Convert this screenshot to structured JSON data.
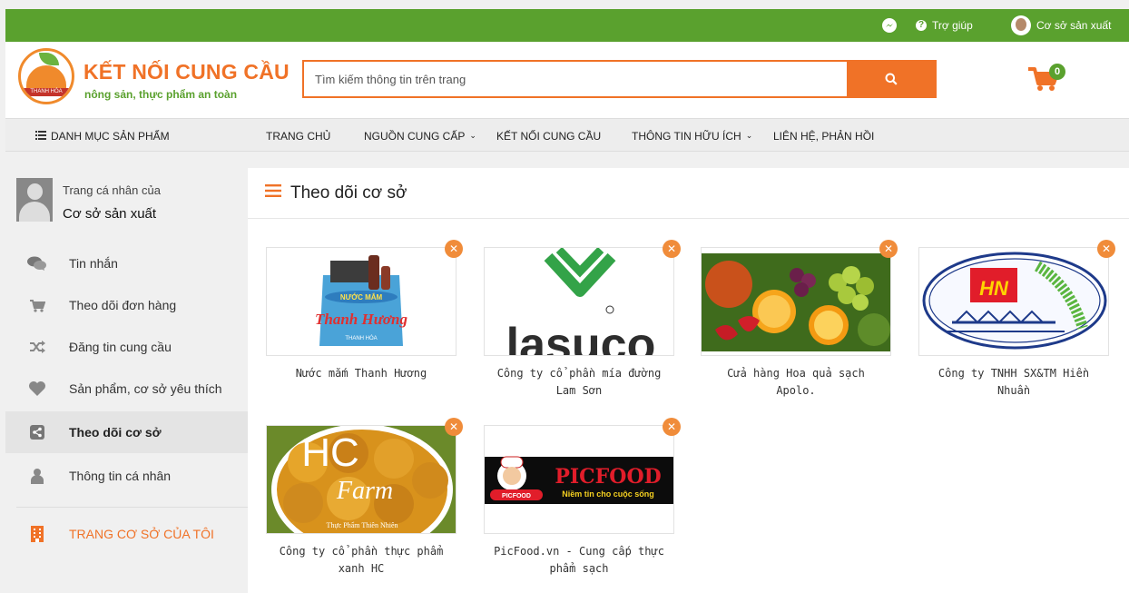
{
  "topbar": {
    "help": "Trợ giúp",
    "account": "Cơ sở sản xuất"
  },
  "logo": {
    "title": "KẾT NỐI CUNG CẦU",
    "subtitle": "nông sản, thực phẩm an toàn",
    "badge": "THANH HÓA"
  },
  "search": {
    "placeholder": "Tìm kiếm thông tin trên trang"
  },
  "cart": {
    "count": "0"
  },
  "nav": {
    "categories": "DANH MỤC SẢN PHẨM",
    "items": [
      "TRANG CHỦ",
      "NGUỒN CUNG CẤP",
      "KẾT NỐI CUNG CẦU",
      "THÔNG TIN HỮU ÍCH",
      "LIÊN HỆ, PHẢN HỒI"
    ]
  },
  "sidebar": {
    "profile_label": "Trang cá nhân của",
    "profile_name": "Cơ sở sản xuất",
    "items": [
      {
        "label": "Tin nhắn",
        "icon": "chat-icon"
      },
      {
        "label": "Theo dõi đơn hàng",
        "icon": "cart-icon"
      },
      {
        "label": "Đăng tin cung cầu",
        "icon": "shuffle-icon"
      },
      {
        "label": "Sản phẩm, cơ sở yêu thích",
        "icon": "heart-icon"
      },
      {
        "label": "Theo dõi cơ sở",
        "icon": "share-icon"
      },
      {
        "label": "Thông tin cá nhân",
        "icon": "user-icon"
      }
    ],
    "my_page": "TRANG CƠ SỞ CỦA TÔI"
  },
  "main": {
    "title": "Theo dõi cơ sở",
    "cards": [
      {
        "name_l1": "Nước mắm Thanh Hương",
        "name_l2": "",
        "image_text": "Thanh Hương"
      },
      {
        "name_l1": "Công ty cổ phần mía đường",
        "name_l2": "Lam Sơn",
        "image_text": "lasuco"
      },
      {
        "name_l1": "Cửa hàng Hoa quả sạch",
        "name_l2": "Apolo.",
        "image_text": ""
      },
      {
        "name_l1": "Công ty TNHH SX&TM Hiền",
        "name_l2": "Nhuần",
        "image_text": "HN"
      },
      {
        "name_l1": "Công ty cổ phần thực phẩm",
        "name_l2": "xanh HC",
        "image_text": "HC"
      },
      {
        "name_l1": "PicFood.vn - Cung cấp thực",
        "name_l2": "phẩm sạch",
        "image_text": "PICFOOD"
      }
    ]
  },
  "colors": {
    "green": "#5aa12e",
    "orange": "#f07227"
  }
}
